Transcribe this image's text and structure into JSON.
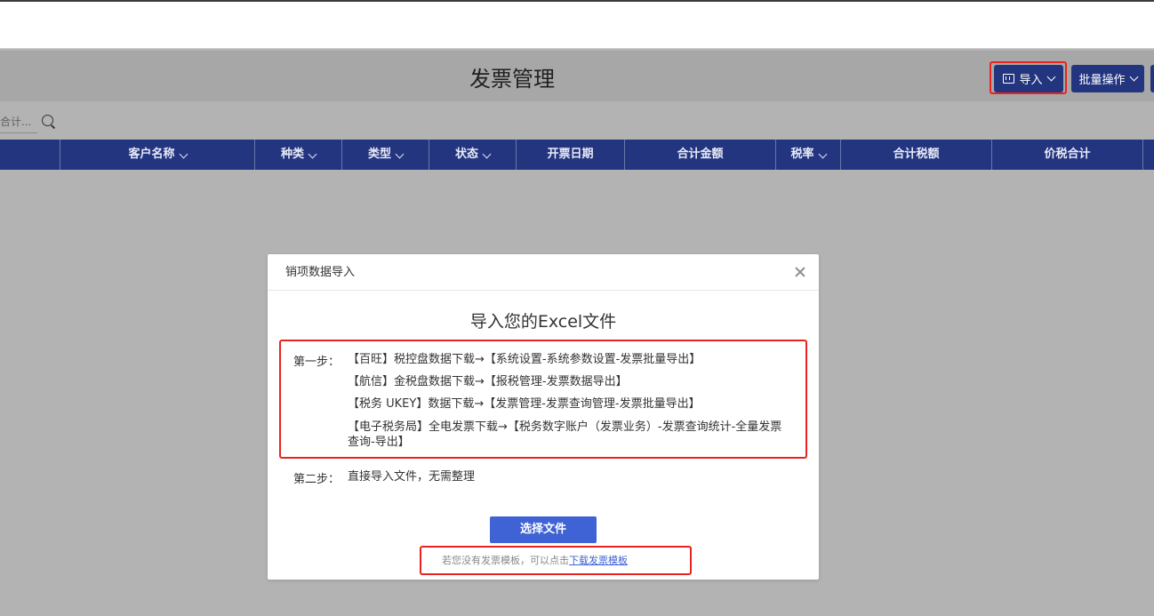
{
  "page": {
    "title": "发票管理"
  },
  "toolbar": {
    "import_label": "导入",
    "batch_label": "批量操作"
  },
  "search": {
    "placeholder": "合计..."
  },
  "table": {
    "columns": [
      "客户名称",
      "种类",
      "类型",
      "状态",
      "开票日期",
      "合计金额",
      "税率",
      "合计税额",
      "价税合计"
    ]
  },
  "modal": {
    "title": "销项数据导入",
    "heading": "导入您的Excel文件",
    "step1_label": "第一步：",
    "step1_lines": [
      "【百旺】税控盘数据下载→【系统设置-系统参数设置-发票批量导出】",
      "【航信】金税盘数据下载→【报税管理-发票数据导出】",
      "【税务 UKEY】数据下载→【发票管理-发票查询管理-发票批量导出】",
      "【电子税务局】全电发票下载→【税务数字账户（发票业务）-发票查询统计-全量发票查询-导出】"
    ],
    "step2_label": "第二步：",
    "step2_text": "直接导入文件，无需整理",
    "select_button": "选择文件",
    "hint_text": "若您没有发票模板，可以点击",
    "hint_link": "下载发票模板"
  },
  "colors": {
    "primary": "#24357f",
    "button_blue": "#3f62d4",
    "highlight_red": "#e8231f",
    "overlay_gray": "#b3b3b3"
  }
}
